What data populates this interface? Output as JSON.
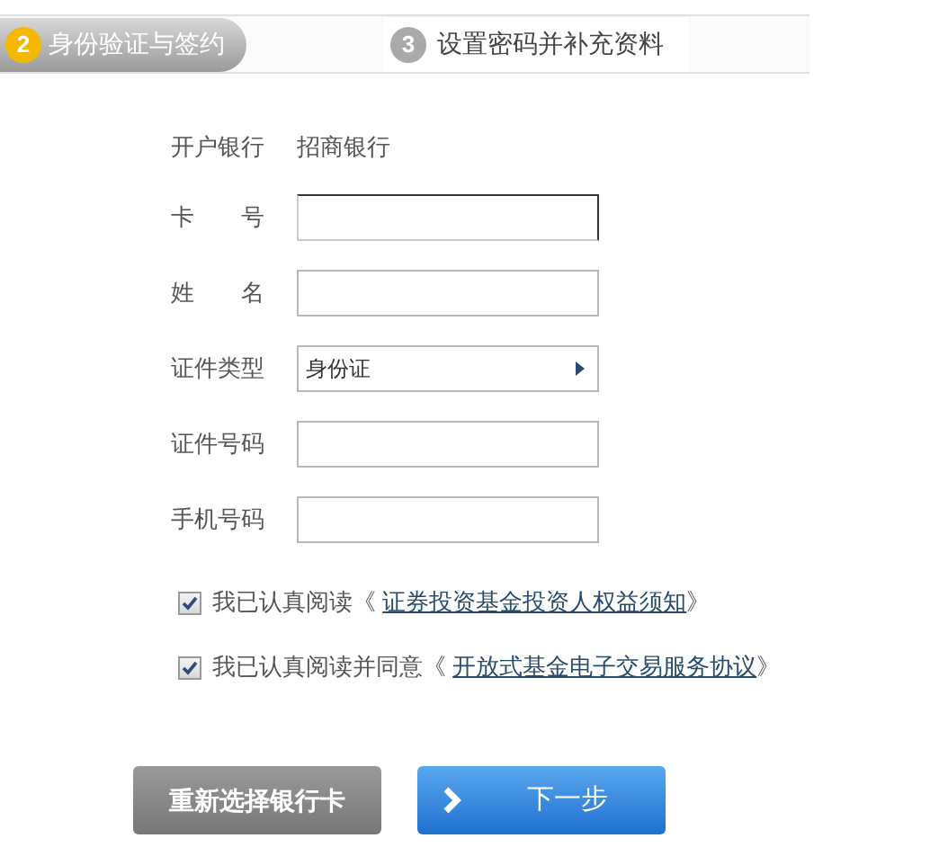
{
  "steps": [
    {
      "number": "2",
      "label": "身份验证与签约",
      "selected": true
    },
    {
      "number": "3",
      "label": "设置密码并补充资料",
      "selected": false
    }
  ],
  "form": {
    "fields": [
      {
        "kind": "text",
        "label": "开户银行",
        "value": "招商银行"
      },
      {
        "kind": "input",
        "label": "卡号",
        "focused": true
      },
      {
        "kind": "input",
        "label": "姓名",
        "focused": false
      },
      {
        "kind": "select",
        "label": "证件类型",
        "value": "身份证"
      },
      {
        "kind": "input",
        "label": "证件号码",
        "focused": false
      },
      {
        "kind": "input",
        "label": "手机号码",
        "focused": false
      }
    ]
  },
  "agreements": [
    {
      "text": "我已认真阅读《",
      "link": "证券投资基金投资人权益须知",
      "suffix": "》",
      "checked": true
    },
    {
      "text": "我已认真阅读并同意《",
      "link": "开放式基金电子交易服务协议",
      "suffix": "》",
      "checked": true
    }
  ],
  "buttons": [
    {
      "kind": "secondary",
      "label": "重新选择银行卡"
    },
    {
      "kind": "primary",
      "label": "下一步"
    }
  ]
}
